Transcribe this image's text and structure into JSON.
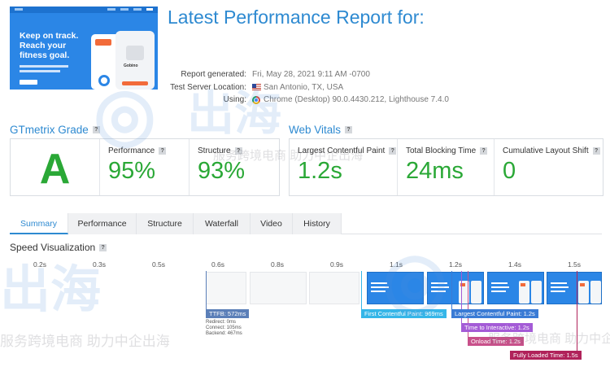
{
  "screenshot": {
    "headline": "Keep on track. Reach your fitness goal.",
    "product_name": "Gobino"
  },
  "report": {
    "title": "Latest Performance Report for:",
    "labels": {
      "generated": "Report generated:",
      "server": "Test Server Location:",
      "using": "Using:"
    },
    "values": {
      "generated": "Fri, May 28, 2021 9:11 AM -0700",
      "server": "San Antonio, TX, USA",
      "using": "Chrome (Desktop) 90.0.4430.212, Lighthouse 7.4.0"
    }
  },
  "grade": {
    "section_title": "GTmetrix Grade",
    "letter": "A",
    "performance_label": "Performance",
    "performance_value": "95%",
    "structure_label": "Structure",
    "structure_value": "93%"
  },
  "vitals": {
    "section_title": "Web Vitals",
    "lcp_label": "Largest Contentful Paint",
    "lcp_value": "1.2s",
    "tbt_label": "Total Blocking Time",
    "tbt_value": "24ms",
    "cls_label": "Cumulative Layout Shift",
    "cls_value": "0"
  },
  "tabs": [
    "Summary",
    "Performance",
    "Structure",
    "Waterfall",
    "Video",
    "History"
  ],
  "active_tab": "Summary",
  "speed_viz": {
    "title": "Speed Visualization",
    "ticks": [
      "0.2s",
      "0.3s",
      "0.5s",
      "0.6s",
      "0.8s",
      "0.9s",
      "1.1s",
      "1.2s",
      "1.4s",
      "1.5s"
    ],
    "markers": {
      "ttfb": "TTFB: 572ms",
      "fcp": "First Contentful Paint: 969ms",
      "lcp": "Largest Contentful Paint: 1.2s",
      "tti": "Time to Interactive: 1.2s",
      "onload": "Onload Time: 1.2s",
      "fully_loaded": "Fully Loaded Time: 1.5s"
    },
    "ttfb_details": {
      "redirect": "Redirect: 0ms",
      "connect": "Connect: 105ms",
      "backend": "Backend: 467ms"
    },
    "colors": {
      "ttfb": "#5b7fb8",
      "fcp": "#35b6e8",
      "lcp": "#3a7bd5",
      "tti": "#a45bd6",
      "onload": "#c8508a",
      "fully_loaded": "#b0225a"
    }
  },
  "watermark": {
    "text": "服务跨境电商 助力中企出海"
  },
  "icons": [
    "help-icon",
    "flag-us-icon",
    "chrome-icon"
  ]
}
